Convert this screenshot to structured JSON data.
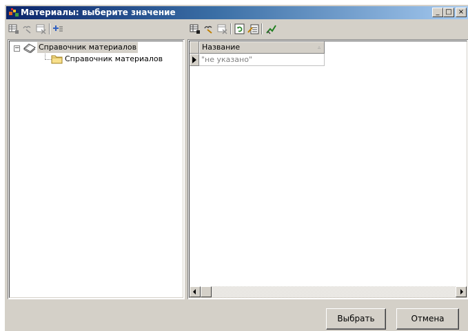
{
  "window": {
    "title": "Материалы: выберите значение",
    "controls": {
      "minimize": "_",
      "maximize": "□",
      "close": "×"
    }
  },
  "tree_toolbar": {
    "buttons": [
      "add-icon",
      "edit-icon",
      "delete-icon",
      "add-group-icon"
    ]
  },
  "grid_toolbar": {
    "buttons": [
      "add-icon",
      "edit-icon",
      "delete-icon",
      "refresh-icon",
      "properties-icon",
      "select-icon"
    ]
  },
  "tree": {
    "root_label": "Справочник материалов",
    "child_label": "Справочник материалов"
  },
  "grid": {
    "column_header": "Название",
    "sort_glyph": "▵",
    "rows": [
      {
        "name": "\"не указано\""
      }
    ]
  },
  "footer": {
    "select_label": "Выбрать",
    "cancel_label": "Отмена"
  }
}
